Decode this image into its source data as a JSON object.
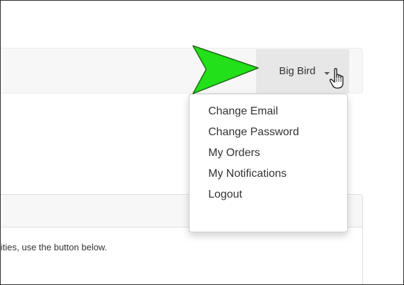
{
  "navbar": {
    "user_menu": {
      "label": "Big Bird",
      "caret_icon": "caret-down-icon",
      "items": [
        {
          "label": "Change Email"
        },
        {
          "label": "Change Password"
        },
        {
          "label": "My Orders"
        },
        {
          "label": "My Notifications"
        },
        {
          "label": "Logout"
        }
      ]
    }
  },
  "panel": {
    "body_text": "ities, use the button below."
  },
  "annotation": {
    "arrow_color": "#22e01a",
    "arrow_icon": "pointer-arrow-icon"
  },
  "cursor_icon": "hand-pointer-icon",
  "colors": {
    "navbar_bg": "#f7f7f7",
    "toggle_active_bg": "#e7e7e7",
    "text": "#333333",
    "border": "#dedede"
  }
}
